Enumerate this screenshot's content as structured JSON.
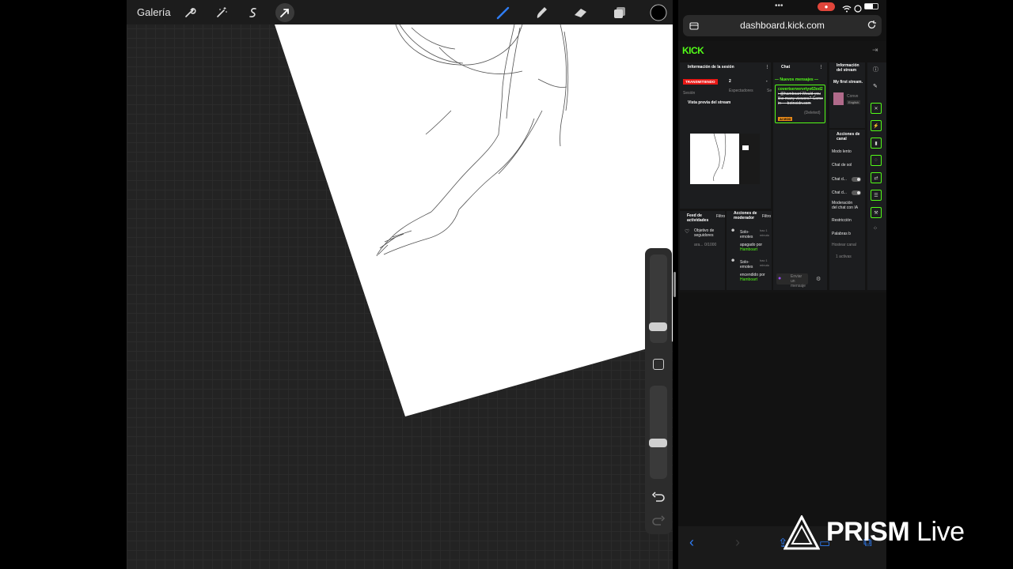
{
  "procreate": {
    "gallery_label": "Galería",
    "toolbar_left_icons": [
      "wrench-icon",
      "magic-wand-icon",
      "selection-icon",
      "transform-arrow-icon"
    ],
    "toolbar_right_icons": [
      "brush-icon",
      "smudge-icon",
      "eraser-icon",
      "layers-icon",
      "color-swatch-icon"
    ],
    "accent": "#2f7df6",
    "current_color": "#000000"
  },
  "status_bar": {
    "dots": "•••",
    "record_indicator": "●"
  },
  "safari": {
    "url": "dashboard.kick.com",
    "reload_icon": "reload-icon",
    "tabs_icon": "tab-overview-icon"
  },
  "kick": {
    "logo": "KICK",
    "session_panel": {
      "title": "Información de la sesión",
      "live_badge": "TRANSMITIENDO",
      "session_label": "Sesión",
      "viewers_value": "2",
      "viewers_label": "Espectadores",
      "truncated_stat": "Se",
      "dash": "-",
      "preview_title": "Vista previa del stream"
    },
    "chat": {
      "title": "Chat",
      "new_messages": "— Nuevos mensajes —",
      "msg_user": "covertservervrtyo63od2",
      "msg_text": ": @hamboart Would you like many viewers? Come in --- botnoidn.com",
      "msg_deleted": "(Deleted)",
      "msg_badge": "AI MOD",
      "send_placeholder": "Enviar un mensaje"
    },
    "stream_info": {
      "title": "Información del stream",
      "stream_title": "My first stream.",
      "category": "Conve",
      "language": "English"
    },
    "channel_actions": {
      "title": "Acciones de canal",
      "items": [
        "Modo lento",
        "Chat de sol",
        "Chat d...",
        "Chat d...",
        "Moderación del chat con IA",
        "Restricción",
        "Palabras b",
        "Hostear canal",
        "1 activas"
      ]
    },
    "activity_feed": {
      "title": "Feed de actividades",
      "filter": "Filtro",
      "item": "Objetivo de seguidores",
      "item_sub": "ara...",
      "item_value": "0/1000"
    },
    "mod_actions": {
      "title": "Acciones de moderador",
      "filter": "Filtro",
      "entries": [
        {
          "label": "Solo-emotes",
          "status": "apagado por",
          "by": "Hamboart",
          "time": "hac 1 minuto"
        },
        {
          "label": "Solo-emotes",
          "status": "encendido por",
          "by": "Hamboart",
          "time": "hac 1 minuto"
        }
      ]
    },
    "brand_green": "#53fc18"
  },
  "watermark": {
    "brand": "PRISM",
    "suffix": " Live"
  }
}
